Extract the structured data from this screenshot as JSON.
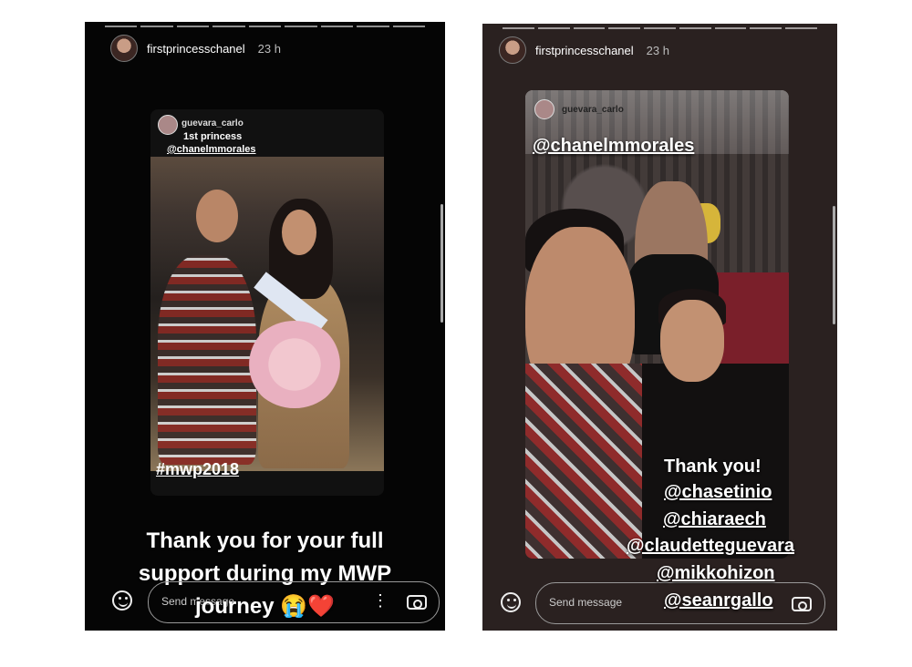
{
  "left": {
    "username": "firstprincesschanel",
    "time": "23 h",
    "embed_user": "guevara_carlo",
    "embed_caption_line1": "1st princess",
    "embed_caption_line2": "@chanelmmorales",
    "hashtag": "#mwp2018",
    "message_line1": "Thank you for your full",
    "message_line2": "support during my MWP",
    "message_line3": "journey 😭❤️",
    "composer_placeholder": "Send message"
  },
  "right": {
    "username": "firstprincesschanel",
    "time": "23 h",
    "embed_user": "guevara_carlo",
    "mention_top": "@chanelmmorales",
    "thanks": "Thank you!",
    "tags": [
      "@chasetinio",
      "@chiaraech",
      "@claudetteguevara",
      "@mikkohizon",
      "@seanrgallo"
    ],
    "composer_placeholder": "Send message"
  },
  "icons": [
    "emoji-icon",
    "more-options-icon",
    "camera-icon"
  ],
  "colors": {
    "story_bg": "#050505",
    "text": "#ffffff"
  }
}
